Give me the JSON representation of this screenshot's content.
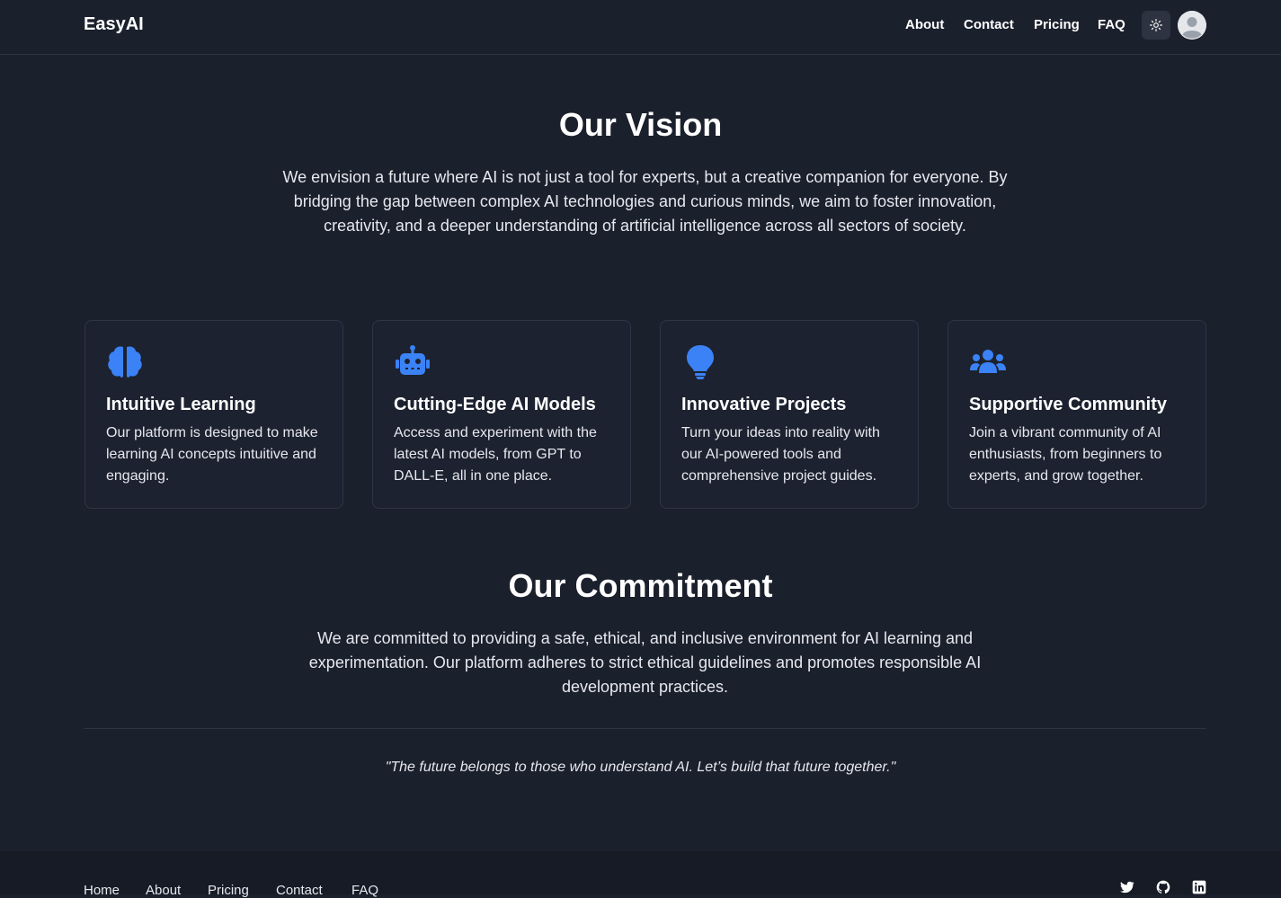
{
  "nav": {
    "brand": "EasyAI",
    "links": [
      "About",
      "Contact",
      "Pricing",
      "FAQ"
    ],
    "theme_icon": "sun-icon",
    "avatar_icon": "user-avatar-icon"
  },
  "vision": {
    "title": "Our Vision",
    "text": "We envision a future where AI is not just a tool for experts, but a creative companion for everyone. By bridging the gap between complex AI technologies and curious minds, we aim to foster innovation, creativity, and a deeper understanding of artificial intelligence across all sectors of society."
  },
  "features": [
    {
      "icon": "brain-icon",
      "title": "Intuitive Learning",
      "text": "Our platform is designed to make learning AI concepts intuitive and engaging."
    },
    {
      "icon": "robot-icon",
      "title": "Cutting-Edge AI Models",
      "text": "Access and experiment with the latest AI models, from GPT to DALL-E, all in one place."
    },
    {
      "icon": "lightbulb-icon",
      "title": "Innovative Projects",
      "text": "Turn your ideas into reality with our AI-powered tools and comprehensive project guides."
    },
    {
      "icon": "users-icon",
      "title": "Supportive Community",
      "text": "Join a vibrant community of AI enthusiasts, from beginners to experts, and grow together."
    }
  ],
  "commitment": {
    "title": "Our Commitment",
    "text": "We are committed to providing a safe, ethical, and inclusive environment for AI learning and experimentation. Our platform adheres to strict ethical guidelines and promotes responsible AI development practices."
  },
  "quote": "\"The future belongs to those who understand AI. Let’s build that future together.\"",
  "footer": {
    "links": [
      "Home",
      "About",
      "Pricing",
      "Contact",
      "FAQ"
    ],
    "social": [
      "twitter-icon",
      "github-icon",
      "linkedin-icon"
    ]
  },
  "colors": {
    "background": "#1b202d",
    "accent": "#3b82f6",
    "card_border": "#2f3544"
  }
}
